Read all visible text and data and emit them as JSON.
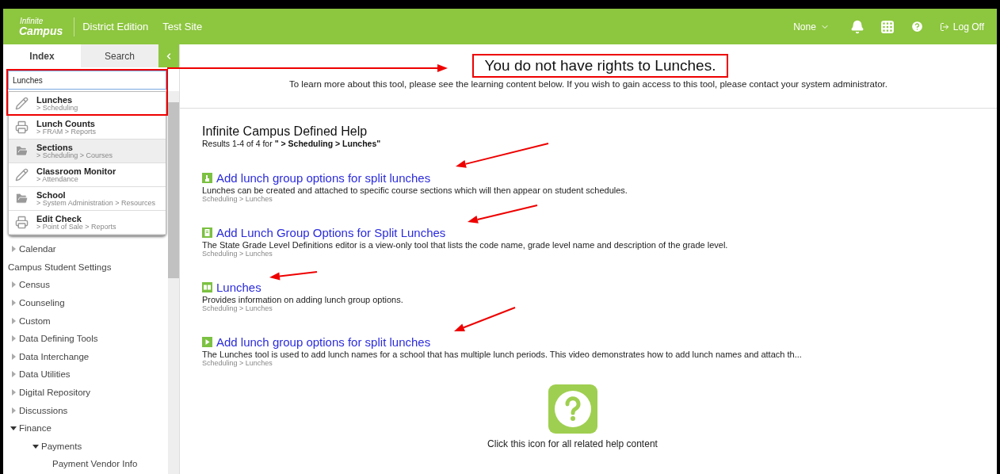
{
  "header": {
    "logo": {
      "line1": "Infinite",
      "line2": "Campus"
    },
    "edition": "District Edition",
    "site": "Test Site",
    "user_menu": "None",
    "logoff": "Log Off"
  },
  "sidebar": {
    "tabs": [
      {
        "label": "Index",
        "selected": true
      },
      {
        "label": "Search",
        "selected": false
      }
    ],
    "search": {
      "value": "Lunches"
    },
    "results": [
      {
        "title": "Lunches",
        "path": "> Scheduling",
        "kind": "tool",
        "hovered": false
      },
      {
        "title": "Lunch Counts",
        "path": "> FRAM > Reports",
        "kind": "report",
        "hovered": false
      },
      {
        "title": "Sections",
        "path": "> Scheduling > Courses",
        "kind": "folder",
        "hovered": true
      },
      {
        "title": "Classroom Monitor",
        "path": "> Attendance",
        "kind": "tool",
        "hovered": false
      },
      {
        "title": "School",
        "path": "> System Administration > Resources",
        "kind": "folder",
        "hovered": false
      },
      {
        "title": "Edit Check",
        "path": "> Point of Sale > Reports",
        "kind": "report",
        "hovered": false
      }
    ],
    "tree": [
      {
        "label": "Calendar",
        "kind": "folder",
        "expanded": false
      },
      {
        "label": "Campus Student Settings",
        "kind": "leaf"
      },
      {
        "label": "Census",
        "kind": "folder",
        "expanded": false
      },
      {
        "label": "Counseling",
        "kind": "folder",
        "expanded": false
      },
      {
        "label": "Custom",
        "kind": "folder",
        "expanded": false
      },
      {
        "label": "Data Defining Tools",
        "kind": "folder",
        "expanded": false
      },
      {
        "label": "Data Interchange",
        "kind": "folder",
        "expanded": false
      },
      {
        "label": "Data Utilities",
        "kind": "folder",
        "expanded": false
      },
      {
        "label": "Digital Repository",
        "kind": "folder",
        "expanded": false
      },
      {
        "label": "Discussions",
        "kind": "folder",
        "expanded": false
      },
      {
        "label": "Finance",
        "kind": "folder",
        "expanded": true,
        "children": [
          {
            "label": "Payments",
            "kind": "folder",
            "expanded": true,
            "children": [
              {
                "label": "Payment Vendor Info",
                "kind": "leaf"
              }
            ]
          }
        ]
      }
    ]
  },
  "notice": {
    "message": "You do not have rights to Lunches.",
    "info": "To learn more about this tool, please see the learning content below. If you wish to gain access to this tool, please contact your system administrator."
  },
  "help": {
    "title": "Infinite Campus Defined Help",
    "summary": "Results 1-4 of 4 for **\" > Scheduling > Lunches\"**",
    "results": [
      {
        "kind": "task",
        "title": "Add lunch group options for split lunches",
        "description": "Lunches can be created and attached to specific course sections which will then appear on student schedules.",
        "path": "Scheduling > Lunches"
      },
      {
        "kind": "document",
        "title": "Add Lunch Group Options for Split Lunches",
        "description": "The State Grade Level Definitions editor is a view-only tool that lists the code name, grade level name and description of the grade level.",
        "path": "Scheduling > Lunches"
      },
      {
        "kind": "book",
        "title": "Lunches",
        "description": "Provides information on adding lunch group options.",
        "path": "Scheduling > Lunches"
      },
      {
        "kind": "video",
        "title": "Add lunch group options for split lunches",
        "description": "The Lunches tool is used to add lunch names for a school that has multiple lunch periods. This video demonstrates how to add lunch names and attach th...",
        "path": "Scheduling > Lunches"
      }
    ],
    "all_help": "Click this icon for all related help content"
  }
}
